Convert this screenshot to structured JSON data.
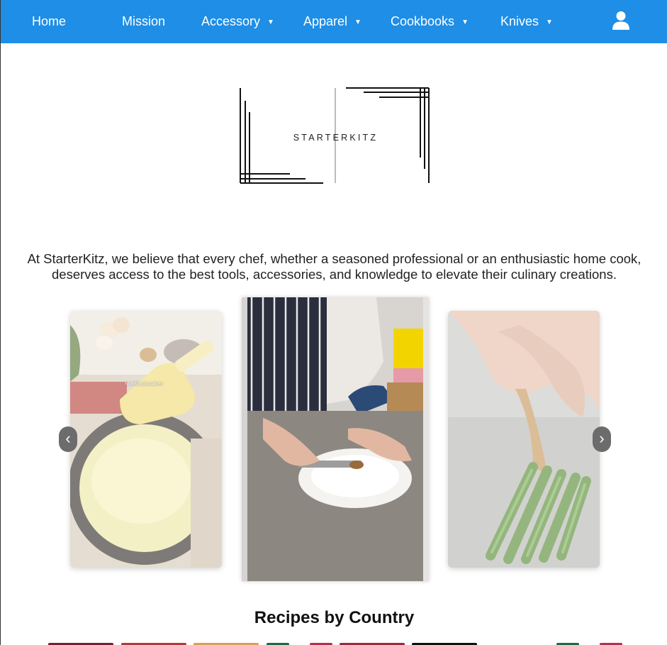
{
  "nav": {
    "items": [
      {
        "label": "Home",
        "has_dropdown": false
      },
      {
        "label": "Mission",
        "has_dropdown": false
      },
      {
        "label": "Accessory",
        "has_dropdown": true
      },
      {
        "label": "Apparel",
        "has_dropdown": true
      },
      {
        "label": "Cookbooks",
        "has_dropdown": true
      },
      {
        "label": "Knives",
        "has_dropdown": true
      }
    ],
    "caret": "▼",
    "user_icon": "user-icon",
    "bar_color": "#1e8ee6"
  },
  "logo": {
    "text": "STARTERKITZ"
  },
  "intro": {
    "line1": "At StarterKitz, we believe that every chef, whether a seasoned professional or an enthusiastic home cook,",
    "line2": "deserves access to the best tools, accessories, and knowledge to elevate their culinary creations."
  },
  "carousel": {
    "left_overlay": "Nutella pancakes",
    "prev": "‹",
    "next": "›"
  },
  "recipes": {
    "title": "Recipes by Country",
    "flag_colors": [
      "#7a1f2b",
      "#b33a3a",
      "#d9a05a",
      "#1f6b45",
      "#b5304a",
      "#9c2a3a",
      "#111111",
      "#1f6b45",
      "#b5304a"
    ]
  }
}
